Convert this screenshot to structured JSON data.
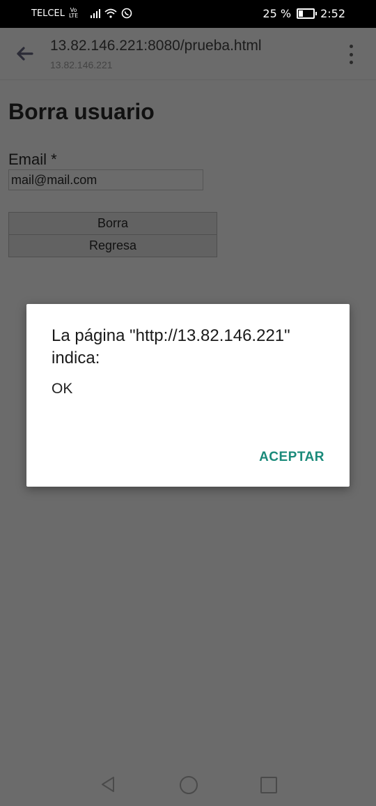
{
  "status_bar": {
    "carrier": "TELCEL",
    "volte_top": "Vo",
    "volte_bottom": "LTE",
    "battery_percent": "25 %",
    "battery_level": 0.25,
    "time": "2:52"
  },
  "url_bar": {
    "title": "13.82.146.221:8080/prueba.html",
    "subtitle": "13.82.146.221"
  },
  "page": {
    "title": "Borra usuario",
    "email_label": "Email *",
    "email_value": "mail@mail.com",
    "borra_button": "Borra",
    "regresa_button": "Regresa"
  },
  "dialog": {
    "title": "La página \"http://13.82.146.221\" indica:",
    "message": "OK",
    "accept_button": "ACEPTAR"
  }
}
